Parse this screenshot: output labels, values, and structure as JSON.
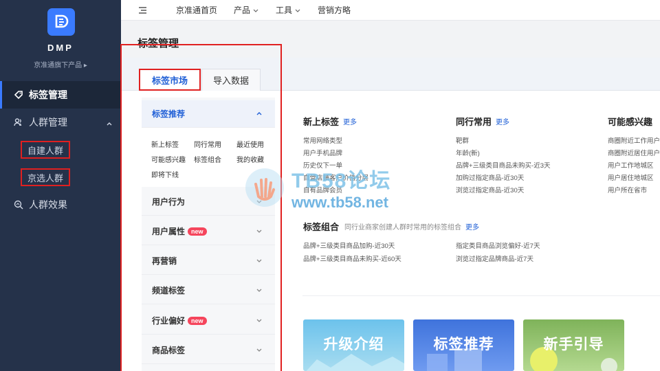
{
  "sidebar": {
    "brand": "DMP",
    "subtitle": "京准通旗下产品 ▸",
    "items": [
      {
        "label": "标签管理"
      },
      {
        "label": "人群管理"
      },
      {
        "label": "人群效果"
      }
    ],
    "sub_items": [
      {
        "label": "自建人群"
      },
      {
        "label": "京选人群"
      }
    ]
  },
  "topbar": {
    "items": [
      {
        "label": "京准通首页"
      },
      {
        "label": "产品"
      },
      {
        "label": "工具"
      },
      {
        "label": "营销方略"
      }
    ]
  },
  "page": {
    "title": "标签管理"
  },
  "tabs": [
    {
      "label": "标签市场",
      "active": true
    },
    {
      "label": "导入数据",
      "active": false
    }
  ],
  "left_panel": {
    "sections": [
      {
        "label": "标签推荐",
        "expanded": true
      },
      {
        "label": "用户行为"
      },
      {
        "label": "用户属性",
        "badge": "new"
      },
      {
        "label": "再营销"
      },
      {
        "label": "频道标签"
      },
      {
        "label": "行业偏好",
        "badge": "new"
      },
      {
        "label": "商品标签"
      }
    ],
    "recommend_tags": [
      "新上标签",
      "同行常用",
      "最近使用",
      "可能感兴趣",
      "标签组合",
      "我的收藏",
      "即将下线"
    ]
  },
  "main": {
    "more_label": "更多",
    "columns": [
      {
        "title": "新上标签",
        "items": [
          "常用网络类型",
          "用户手机品牌",
          "历史仅下一单",
          "自营店铺客户价值分层",
          "自有品牌会员"
        ]
      },
      {
        "title": "同行常用",
        "items": [
          "靶群",
          "年龄(新)",
          "品牌+三级类目商品未购买-近3天",
          "加购过指定商品-近30天",
          "浏览过指定商品-近30天"
        ]
      },
      {
        "title": "可能感兴趣",
        "items": [
          "商圈附近工作用户",
          "商圈附近居住用户",
          "用户工作地城区",
          "用户居住地城区",
          "用户所在省市"
        ]
      }
    ],
    "combo": {
      "title": "标签组合",
      "desc": "同行业商家创建人群时常用的标签组合",
      "items": [
        "品牌+三级类目商品加购-近30天",
        "指定类目商品浏览偏好-近7天",
        "品牌+三级类目商品未购买-近60天",
        "浏览过指定品牌商品-近7天"
      ]
    },
    "cards": [
      {
        "label": "升级介绍",
        "color": "#7cc4e6"
      },
      {
        "label": "标签推荐",
        "color": "#4d7fe0"
      },
      {
        "label": "新手引导",
        "color": "#8fbf6a"
      }
    ]
  },
  "watermark": {
    "title": "TB58论坛",
    "url": "www.tb58.net"
  },
  "colors": {
    "sidebar": "#25324a",
    "accent": "#1f5fd6",
    "highlight": "#e02020",
    "badge": "#f5455c"
  }
}
